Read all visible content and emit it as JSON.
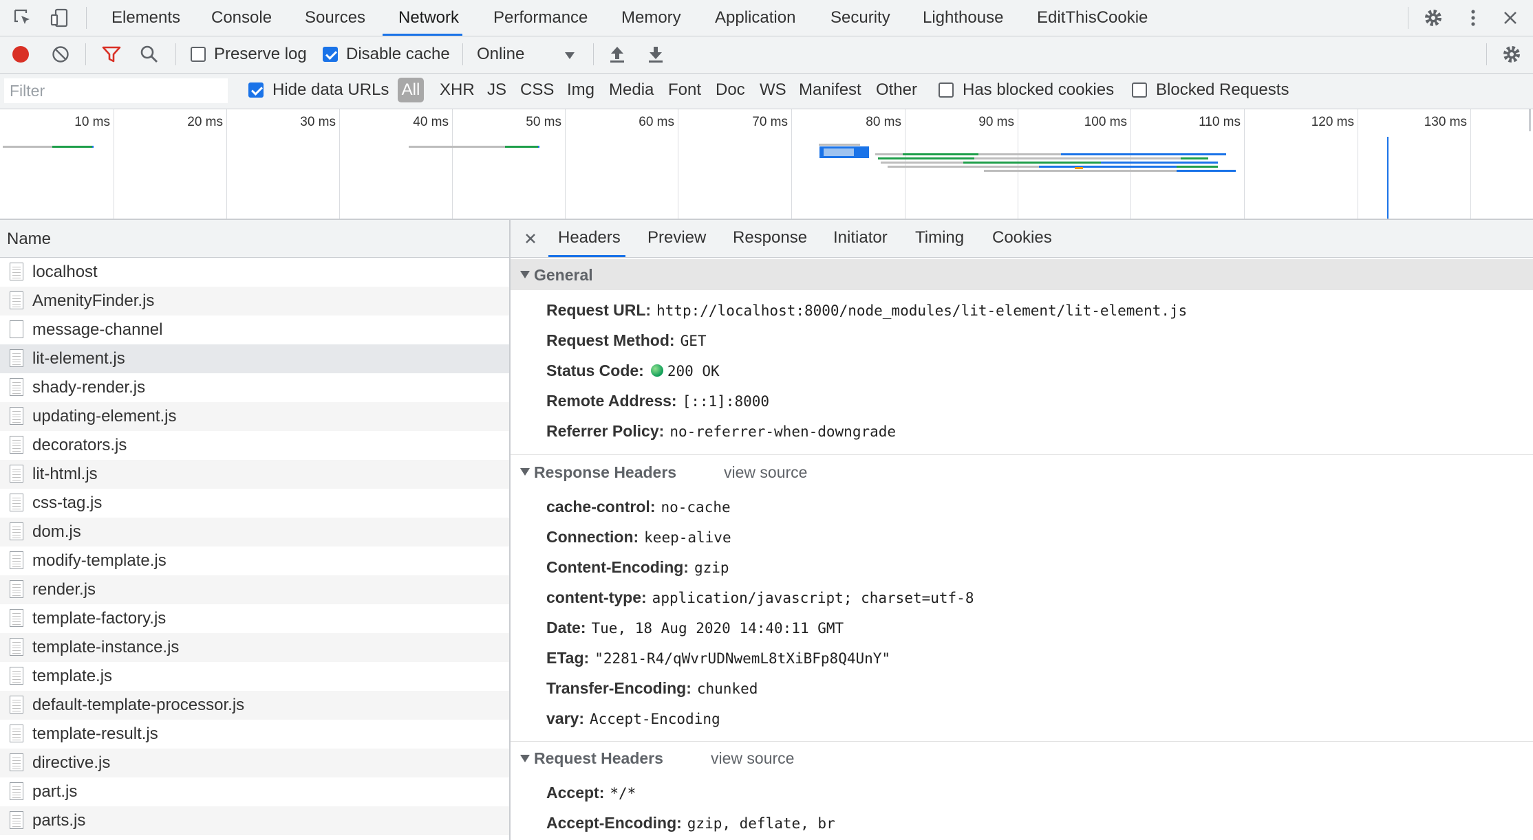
{
  "topbar": {
    "tabs": [
      "Elements",
      "Console",
      "Sources",
      "Network",
      "Performance",
      "Memory",
      "Application",
      "Security",
      "Lighthouse",
      "EditThisCookie"
    ],
    "active_tab": "Network"
  },
  "toolbar": {
    "preserve_log_label": "Preserve log",
    "preserve_log_checked": false,
    "disable_cache_label": "Disable cache",
    "disable_cache_checked": true,
    "throttle_value": "Online"
  },
  "filterbar": {
    "placeholder": "Filter",
    "hide_data_urls_label": "Hide data URLs",
    "hide_data_urls_checked": true,
    "types": [
      "All",
      "XHR",
      "JS",
      "CSS",
      "Img",
      "Media",
      "Font",
      "Doc",
      "WS",
      "Manifest",
      "Other"
    ],
    "active_type": "All",
    "has_blocked_cookies_label": "Has blocked cookies",
    "blocked_requests_label": "Blocked Requests"
  },
  "overview": {
    "tick_labels": [
      "10 ms",
      "20 ms",
      "30 ms",
      "40 ms",
      "50 ms",
      "60 ms",
      "70 ms",
      "80 ms",
      "90 ms",
      "100 ms",
      "110 ms",
      "120 ms",
      "130 ms"
    ]
  },
  "request_list": {
    "column_header": "Name",
    "selected": "lit-element.js",
    "rows": [
      "localhost",
      "AmenityFinder.js",
      "message-channel",
      "lit-element.js",
      "shady-render.js",
      "updating-element.js",
      "decorators.js",
      "lit-html.js",
      "css-tag.js",
      "dom.js",
      "modify-template.js",
      "render.js",
      "template-factory.js",
      "template-instance.js",
      "template.js",
      "default-template-processor.js",
      "template-result.js",
      "directive.js",
      "part.js",
      "parts.js"
    ]
  },
  "details": {
    "tabs": [
      "Headers",
      "Preview",
      "Response",
      "Initiator",
      "Timing",
      "Cookies"
    ],
    "active_tab": "Headers",
    "general": {
      "title": "General",
      "request_url_key": "Request URL:",
      "request_url": "http://localhost:8000/node_modules/lit-element/lit-element.js",
      "request_method_key": "Request Method:",
      "request_method": "GET",
      "status_code_key": "Status Code:",
      "status_code": "200 OK",
      "remote_address_key": "Remote Address:",
      "remote_address": "[::1]:8000",
      "referrer_policy_key": "Referrer Policy:",
      "referrer_policy": "no-referrer-when-downgrade"
    },
    "response_headers": {
      "title": "Response Headers",
      "view_source": "view source",
      "items": [
        {
          "key": "cache-control:",
          "value": "no-cache"
        },
        {
          "key": "Connection:",
          "value": "keep-alive"
        },
        {
          "key": "Content-Encoding:",
          "value": "gzip"
        },
        {
          "key": "content-type:",
          "value": "application/javascript; charset=utf-8"
        },
        {
          "key": "Date:",
          "value": "Tue, 18 Aug 2020 14:40:11 GMT"
        },
        {
          "key": "ETag:",
          "value": "\"2281-R4/qWvrUDNwemL8tXiBFp8Q4UnY\""
        },
        {
          "key": "Transfer-Encoding:",
          "value": "chunked"
        },
        {
          "key": "vary:",
          "value": "Accept-Encoding"
        }
      ]
    },
    "request_headers": {
      "title": "Request Headers",
      "view_source": "view source",
      "items": [
        {
          "key": "Accept:",
          "value": "*/*"
        },
        {
          "key": "Accept-Encoding:",
          "value": "gzip, deflate, br"
        }
      ]
    }
  },
  "colors": {
    "accent": "#1a73e8",
    "record": "#d93025",
    "status_ok": "#0f9d58",
    "filter_active": "#d93025"
  }
}
